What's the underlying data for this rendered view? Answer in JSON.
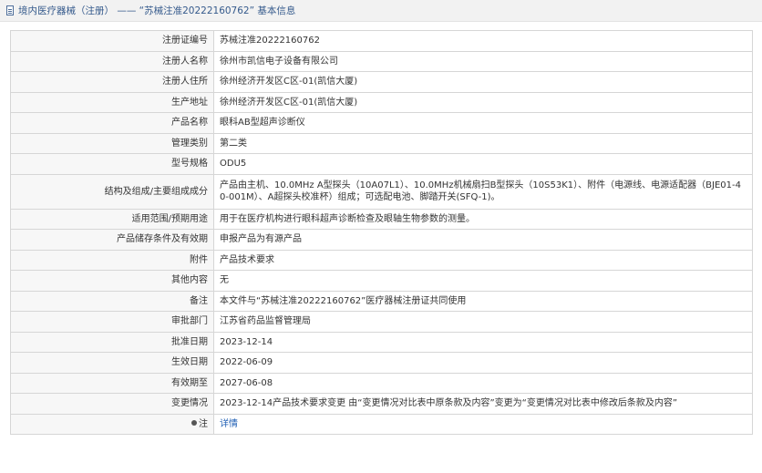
{
  "header": {
    "title": "境内医疗器械（注册） —— “苏械注准20222160762” 基本信息"
  },
  "rows": [
    {
      "label": "注册证编号",
      "value": "苏械注准20222160762"
    },
    {
      "label": "注册人名称",
      "value": "徐州市凯信电子设备有限公司"
    },
    {
      "label": "注册人住所",
      "value": "徐州经济开发区C区-01(凯信大厦)"
    },
    {
      "label": "生产地址",
      "value": "徐州经济开发区C区-01(凯信大厦)"
    },
    {
      "label": "产品名称",
      "value": "眼科AB型超声诊断仪"
    },
    {
      "label": "管理类别",
      "value": "第二类"
    },
    {
      "label": "型号规格",
      "value": "ODU5"
    },
    {
      "label": "结构及组成/主要组成成分",
      "value": "产品由主机、10.0MHz A型探头（10A07L1）、10.0MHz机械扇扫B型探头（10S53K1）、附件（电源线、电源适配器（BJE01-40-001M）、A超探头校准杯）组成；可选配电池、脚踏开关(SFQ-1)。"
    },
    {
      "label": "适用范围/预期用途",
      "value": "用于在医疗机构进行眼科超声诊断检查及眼轴生物参数的测量。"
    },
    {
      "label": "产品储存条件及有效期",
      "value": "申报产品为有源产品"
    },
    {
      "label": "附件",
      "value": "产品技术要求"
    },
    {
      "label": "其他内容",
      "value": "无"
    },
    {
      "label": "备注",
      "value": "本文件与“苏械注准20222160762”医疗器械注册证共同使用"
    },
    {
      "label": "审批部门",
      "value": "江苏省药品监督管理局"
    },
    {
      "label": "批准日期",
      "value": "2023-12-14"
    },
    {
      "label": "生效日期",
      "value": "2022-06-09"
    },
    {
      "label": "有效期至",
      "value": "2027-06-08"
    },
    {
      "label": "变更情况",
      "value": "2023-12-14产品技术要求变更 由“变更情况对比表中原条款及内容”变更为“变更情况对比表中修改后条款及内容”"
    }
  ],
  "note": {
    "label": "注",
    "link": "详情",
    "icon": "pin-icon"
  },
  "colors": {
    "header_bg": "#f2f2f2",
    "title": "#355a8c",
    "label_bg": "#f7f7f7",
    "border": "#d6d6d6",
    "link": "#1f5fb4"
  }
}
